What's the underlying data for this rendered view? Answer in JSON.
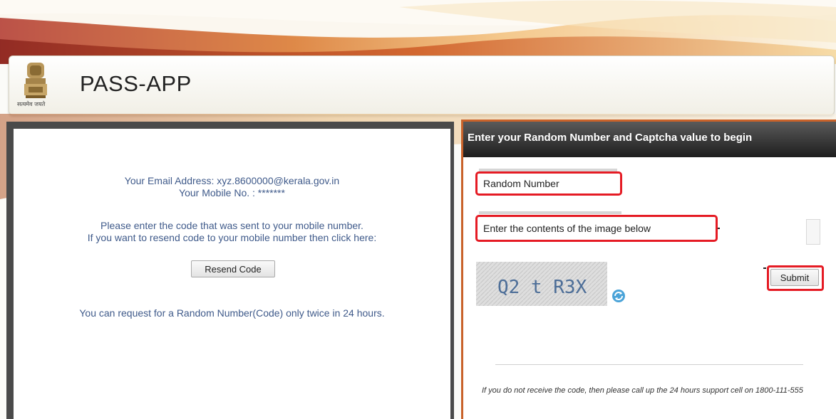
{
  "header": {
    "app_title": "PASS-APP",
    "emblem_caption": "सत्यमेव जयते"
  },
  "left_panel": {
    "email_line": "Your Email Address: xyz.8600000@kerala.gov.in",
    "mobile_line": "Your Mobile No. : *******",
    "instruction_line1": "Please enter the code that was sent to your mobile number.",
    "instruction_line2": "If you want to resend code to your mobile number then click here:",
    "resend_button": "Resend Code",
    "limit_note": "You can request for a Random Number(Code) only twice in 24 hours."
  },
  "right_panel": {
    "heading": "Enter your Random Number and Captcha value to begin",
    "random_number_placeholder": "Random Number",
    "captcha_placeholder": "Enter the contents of the image below",
    "captcha_text": "Q2 t R3X",
    "submit_button": "Submit",
    "support_text": "If you do not receive the code, then please call up the 24 hours support cell on 1800-111-555"
  },
  "colors": {
    "highlight_red": "#e51b24",
    "panel_orange": "#c9622a",
    "text_blue": "#3f5a8a"
  },
  "icons": [
    "national-emblem-icon",
    "refresh-icon"
  ]
}
